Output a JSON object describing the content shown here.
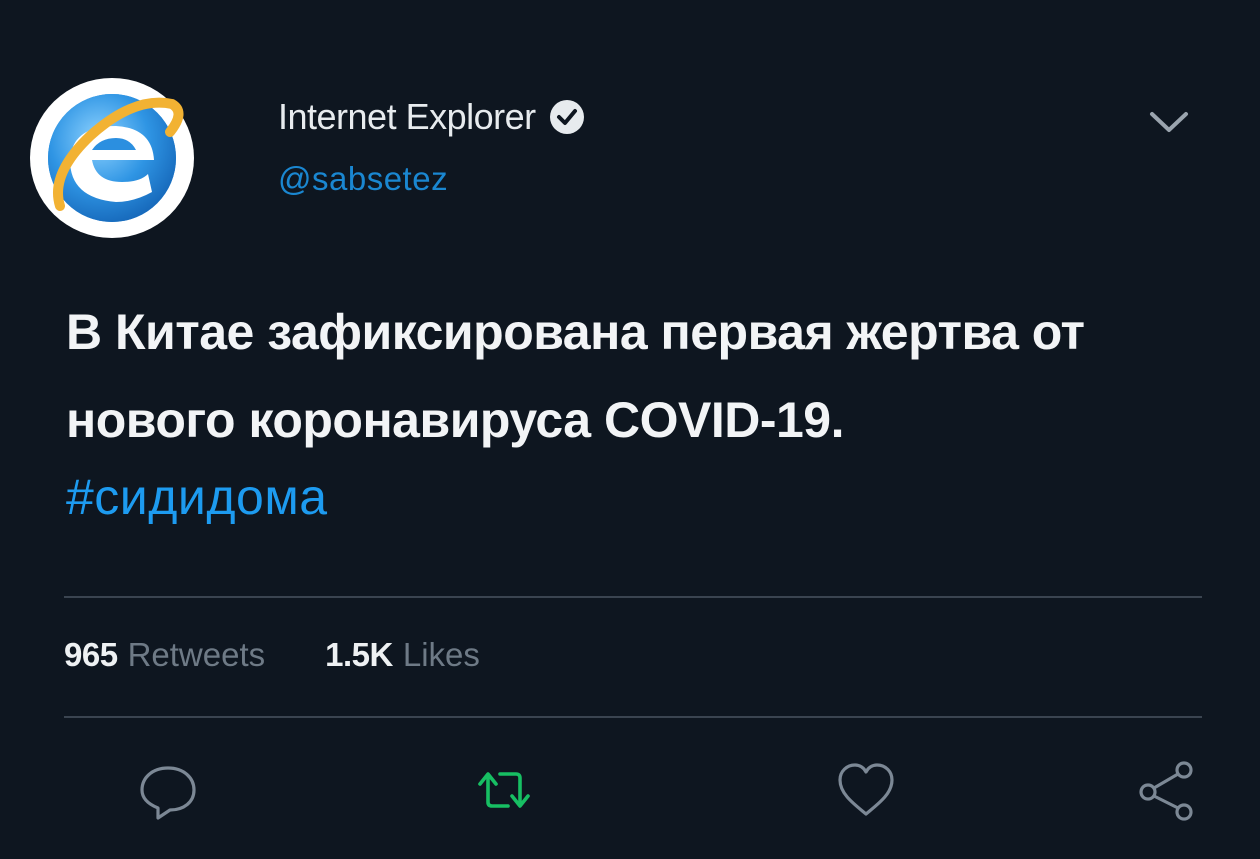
{
  "author": {
    "display_name": "Internet Explorer",
    "handle": "@sabsetez",
    "avatar_icon": "internet-explorer-logo",
    "verified_icon": "verified-badge-icon"
  },
  "tweet": {
    "text_line1": "В Китае зафиксирована первая жертва от",
    "text_line2": "нового коронавируса COVID-19.",
    "hashtag": "#сидидома"
  },
  "stats": {
    "retweets_count": "965",
    "retweets_label": "Retweets",
    "likes_count": "1.5K",
    "likes_label": "Likes"
  },
  "actions": [
    "reply-icon",
    "retweet-icon",
    "like-icon",
    "share-icon"
  ],
  "colors": {
    "background": "#0e1620",
    "link": "#1d9bf0",
    "retweet_active": "#17bf63",
    "muted": "#6e7a86"
  }
}
